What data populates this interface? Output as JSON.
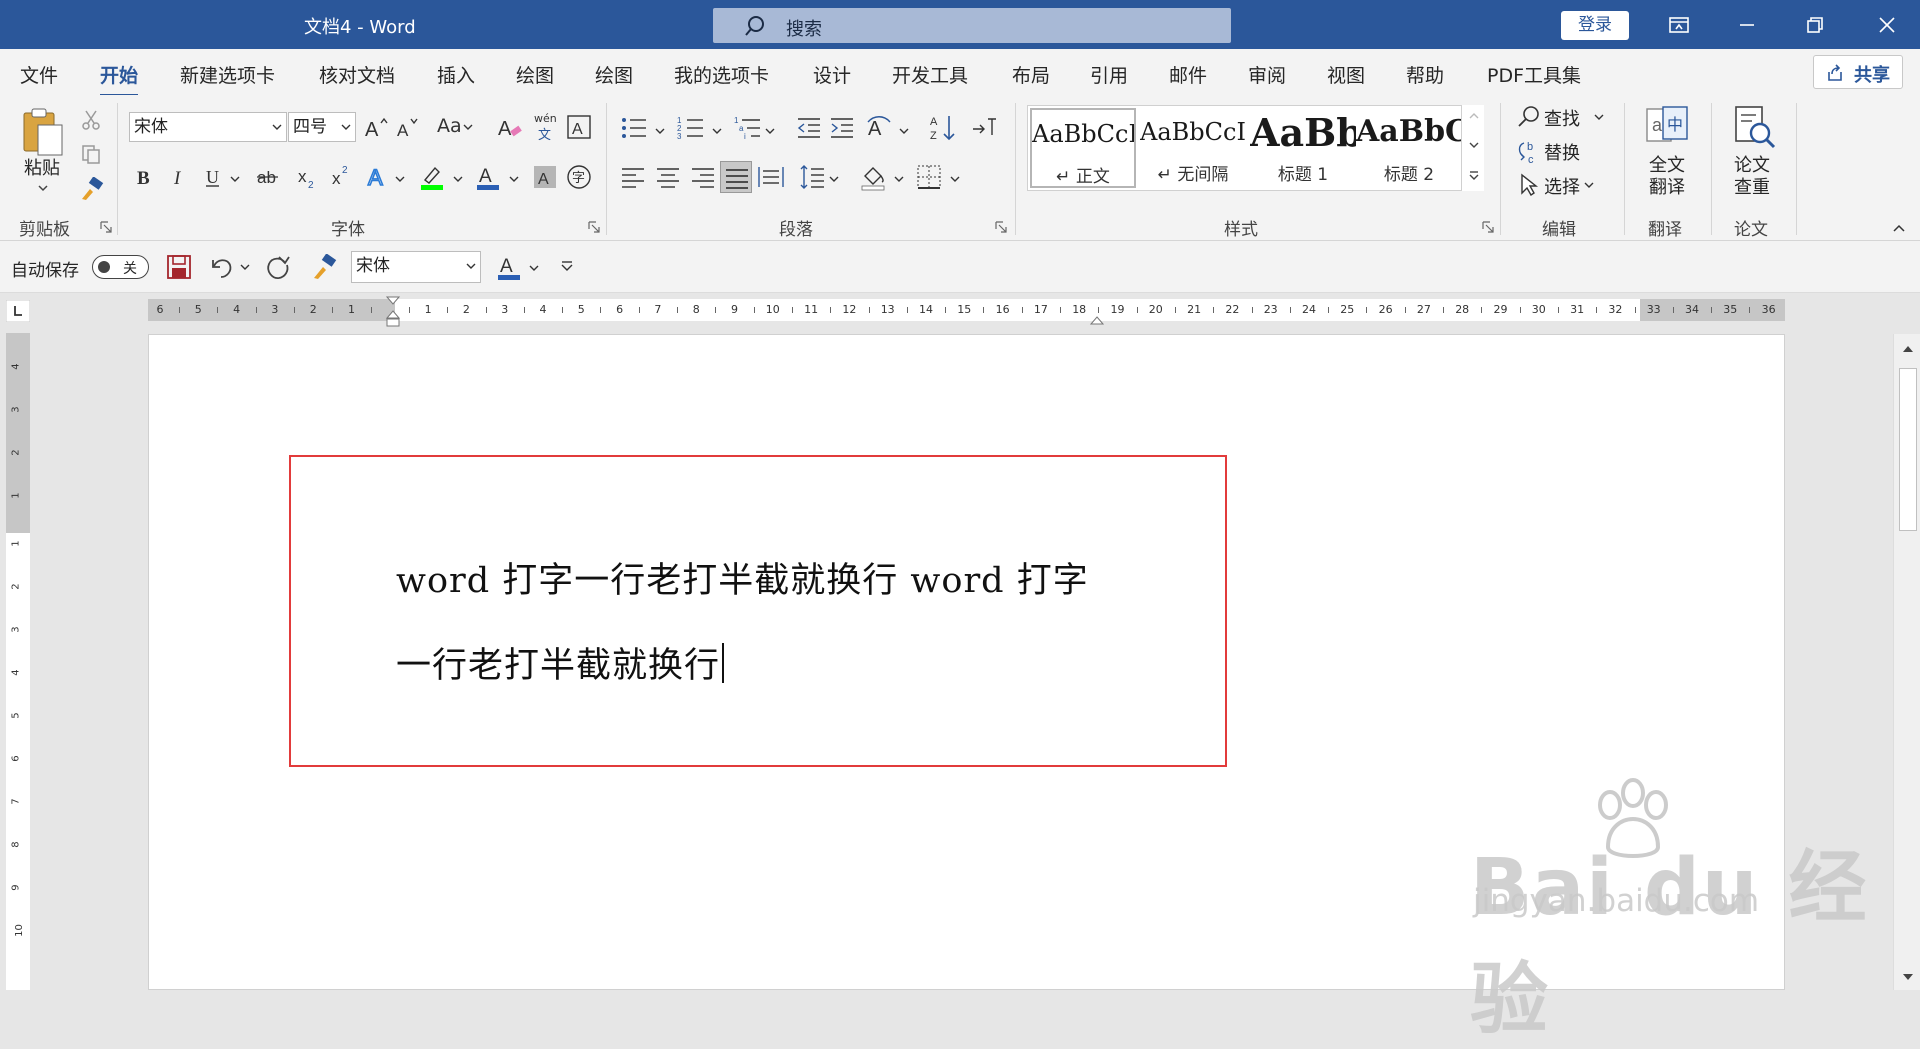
{
  "window": {
    "title": "文档4  -  Word",
    "search_placeholder": "搜索",
    "login_label": "登录"
  },
  "menu": {
    "tabs": [
      "文件",
      "开始",
      "新建选项卡",
      "核对文档",
      "插入",
      "绘图",
      "绘图",
      "我的选项卡",
      "设计",
      "开发工具",
      "布局",
      "引用",
      "邮件",
      "审阅",
      "视图",
      "帮助",
      "PDF工具集"
    ],
    "active_tab": "开始",
    "share_label": "共享"
  },
  "ribbon": {
    "clipboard": {
      "paste_label": "粘贴",
      "group_label": "剪贴板"
    },
    "font": {
      "font_name": "宋体",
      "font_size": "四号",
      "group_label": "字体",
      "change_case_label": "Aa",
      "phonetic_label": "wén"
    },
    "paragraph": {
      "group_label": "段落"
    },
    "styles": {
      "group_label": "样式",
      "items": [
        {
          "preview": "AaBbCcI",
          "name": "↵ 正文"
        },
        {
          "preview": "AaBbCcI",
          "name": "↵ 无间隔"
        },
        {
          "preview": "AaBb",
          "name": "标题 1"
        },
        {
          "preview": "AaBbC",
          "name": "标题 2"
        }
      ]
    },
    "editing": {
      "find_label": "查找",
      "replace_label": "替换",
      "select_label": "选择",
      "group_label": "编辑"
    },
    "translate": {
      "button_label_1": "全文",
      "button_label_2": "翻译",
      "group_label": "翻译"
    },
    "paper": {
      "button_label_1": "论文",
      "button_label_2": "查重",
      "group_label": "论文"
    }
  },
  "qat": {
    "autosave_label": "自动保存",
    "autosave_state": "关",
    "font_name": "宋体"
  },
  "ruler": {
    "numbers": [
      "6",
      "5",
      "4",
      "3",
      "2",
      "1",
      "",
      "1",
      "2",
      "3",
      "4",
      "5",
      "6",
      "7",
      "8",
      "9",
      "10",
      "11",
      "12",
      "13",
      "14",
      "15",
      "16",
      "17",
      "18",
      "19",
      "20",
      "21",
      "22",
      "23",
      "24",
      "25",
      "26",
      "27",
      "28",
      "29",
      "30",
      "31",
      "32",
      "33",
      "34",
      "35",
      "36"
    ],
    "vertical_numbers": [
      "4",
      "3",
      "2",
      "1",
      "1",
      "2",
      "3",
      "4",
      "5",
      "6",
      "7",
      "8",
      "9",
      "10"
    ]
  },
  "document": {
    "lines": [
      "word 打字一行老打半截就换行 word 打字",
      "一行老打半截就换行"
    ]
  },
  "watermark": {
    "logo": "Bai du 经验",
    "url": "jingyan.baidu.com"
  },
  "colors": {
    "brand": "#2b579a",
    "highlight_box": "#e23b3b",
    "highlighter": "#00ff00",
    "font_color": "#2b5fb4"
  }
}
